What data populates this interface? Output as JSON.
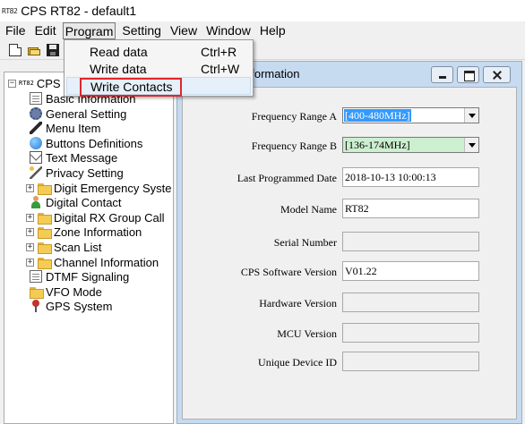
{
  "window": {
    "icon_text": "RT82",
    "title": "CPS RT82 - default1"
  },
  "menubar": {
    "items": [
      "File",
      "Edit",
      "Program",
      "Setting",
      "View",
      "Window",
      "Help"
    ]
  },
  "toolbar": {
    "buttons": [
      "new-icon",
      "open-folder-icon",
      "save-icon"
    ]
  },
  "program_menu": {
    "items": [
      {
        "label": "Read data",
        "shortcut": "Ctrl+R"
      },
      {
        "label": "Write data",
        "shortcut": "Ctrl+W"
      },
      {
        "label": "Write Contacts",
        "shortcut": ""
      }
    ],
    "highlight_color": "#e0262c"
  },
  "tree": {
    "root_icon": "RT82",
    "root_label": "CPS",
    "items": [
      {
        "label": "Basic Information",
        "icon": "document-icon"
      },
      {
        "label": "General Setting",
        "icon": "gear-icon"
      },
      {
        "label": "Menu Item",
        "icon": "pencil-icon"
      },
      {
        "label": "Buttons Definitions",
        "icon": "button-ball-icon"
      },
      {
        "label": "Text Message",
        "icon": "mail-icon"
      },
      {
        "label": "Privacy Setting",
        "icon": "wand-icon"
      },
      {
        "label": "Digit Emergency Syste",
        "icon": "folder-icon"
      },
      {
        "label": "Digital Contact",
        "icon": "contact-person-icon"
      },
      {
        "label": "Digital RX Group Call",
        "icon": "folder-icon"
      },
      {
        "label": "Zone Information",
        "icon": "folder-icon"
      },
      {
        "label": "Scan List",
        "icon": "folder-icon"
      },
      {
        "label": "Channel Information",
        "icon": "folder-icon"
      },
      {
        "label": "DTMF Signaling",
        "icon": "document-icon"
      },
      {
        "label": "VFO Mode",
        "icon": "folder-icon"
      },
      {
        "label": "GPS System",
        "icon": "map-pin-icon"
      }
    ]
  },
  "child_window": {
    "title": "nformation",
    "fields": {
      "freq_a_label": "Frequency Range A",
      "freq_a_value": "[400-480MHz]",
      "freq_b_label": "Frequency Range B",
      "freq_b_value": "[136-174MHz]",
      "last_prog_label": "Last Programmed Date",
      "last_prog_value": "2018-10-13 10:00:13",
      "model_label": "Model Name",
      "model_value": "RT82",
      "serial_label": "Serial Number",
      "serial_value": "",
      "cps_ver_label": "CPS Software Version",
      "cps_ver_value": "V01.22",
      "hw_ver_label": "Hardware Version",
      "hw_ver_value": "",
      "mcu_label": "MCU Version",
      "mcu_value": "",
      "udid_label": "Unique Device ID",
      "udid_value": ""
    }
  }
}
